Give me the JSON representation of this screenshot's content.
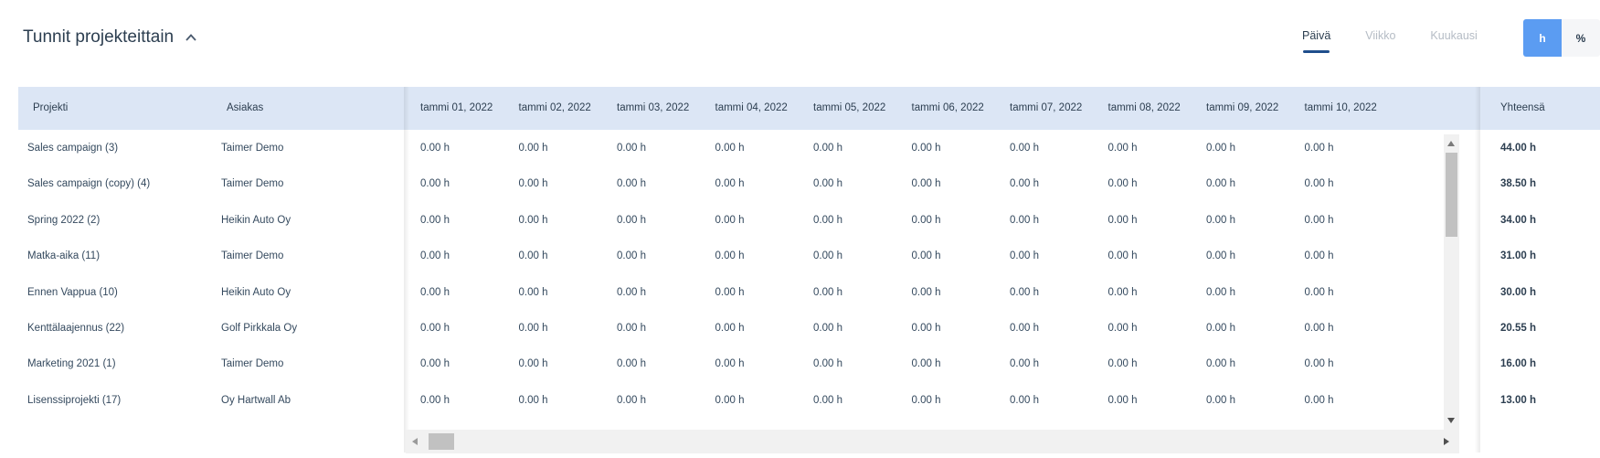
{
  "header": {
    "title": "Tunnit projekteittain",
    "view_tabs": [
      {
        "label": "Päivä",
        "active": true
      },
      {
        "label": "Viikko",
        "active": false
      },
      {
        "label": "Kuukausi",
        "active": false
      }
    ],
    "unit_toggle": [
      {
        "label": "h",
        "active": true
      },
      {
        "label": "%",
        "active": false
      }
    ]
  },
  "table": {
    "columns": {
      "project": "Projekti",
      "customer": "Asiakas",
      "total": "Yhteensä",
      "days": [
        "tammi 01, 2022",
        "tammi 02, 2022",
        "tammi 03, 2022",
        "tammi 04, 2022",
        "tammi 05, 2022",
        "tammi 06, 2022",
        "tammi 07, 2022",
        "tammi 08, 2022",
        "tammi 09, 2022",
        "tammi 10, 2022"
      ]
    },
    "rows": [
      {
        "project": "Sales campaign (3)",
        "customer": "Taimer Demo",
        "total": "44.00 h",
        "values": [
          "0.00 h",
          "0.00 h",
          "0.00 h",
          "0.00 h",
          "0.00 h",
          "0.00 h",
          "0.00 h",
          "0.00 h",
          "0.00 h",
          "0.00 h"
        ]
      },
      {
        "project": "Sales campaign (copy) (4)",
        "customer": "Taimer Demo",
        "total": "38.50 h",
        "values": [
          "0.00 h",
          "0.00 h",
          "0.00 h",
          "0.00 h",
          "0.00 h",
          "0.00 h",
          "0.00 h",
          "0.00 h",
          "0.00 h",
          "0.00 h"
        ]
      },
      {
        "project": "Spring 2022 (2)",
        "customer": "Heikin Auto Oy",
        "total": "34.00 h",
        "values": [
          "0.00 h",
          "0.00 h",
          "0.00 h",
          "0.00 h",
          "0.00 h",
          "0.00 h",
          "0.00 h",
          "0.00 h",
          "0.00 h",
          "0.00 h"
        ]
      },
      {
        "project": "Matka-aika (11)",
        "customer": "Taimer Demo",
        "total": "31.00 h",
        "values": [
          "0.00 h",
          "0.00 h",
          "0.00 h",
          "0.00 h",
          "0.00 h",
          "0.00 h",
          "0.00 h",
          "0.00 h",
          "0.00 h",
          "0.00 h"
        ]
      },
      {
        "project": "Ennen Vappua (10)",
        "customer": "Heikin Auto Oy",
        "total": "30.00 h",
        "values": [
          "0.00 h",
          "0.00 h",
          "0.00 h",
          "0.00 h",
          "0.00 h",
          "0.00 h",
          "0.00 h",
          "0.00 h",
          "0.00 h",
          "0.00 h"
        ]
      },
      {
        "project": "Kenttälaajennus (22)",
        "customer": "Golf Pirkkala Oy",
        "total": "20.55 h",
        "values": [
          "0.00 h",
          "0.00 h",
          "0.00 h",
          "0.00 h",
          "0.00 h",
          "0.00 h",
          "0.00 h",
          "0.00 h",
          "0.00 h",
          "0.00 h"
        ]
      },
      {
        "project": "Marketing 2021 (1)",
        "customer": "Taimer Demo",
        "total": "16.00 h",
        "values": [
          "0.00 h",
          "0.00 h",
          "0.00 h",
          "0.00 h",
          "0.00 h",
          "0.00 h",
          "0.00 h",
          "0.00 h",
          "0.00 h",
          "0.00 h"
        ]
      },
      {
        "project": "Lisenssiprojekti (17)",
        "customer": "Oy Hartwall Ab",
        "total": "13.00 h",
        "values": [
          "0.00 h",
          "0.00 h",
          "0.00 h",
          "0.00 h",
          "0.00 h",
          "0.00 h",
          "0.00 h",
          "0.00 h",
          "0.00 h",
          "0.00 h"
        ]
      }
    ]
  }
}
